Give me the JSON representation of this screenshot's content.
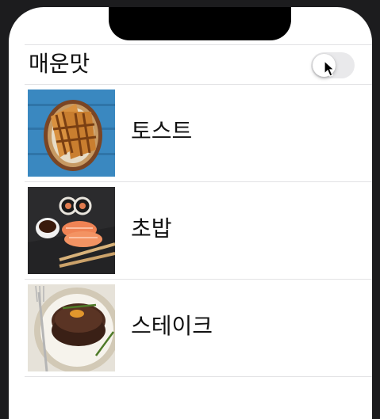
{
  "spicy_toggle": {
    "label": "매운맛",
    "state": "off",
    "track_color": "#e9e9eb",
    "knob_color": "#ffffff"
  },
  "food_items": [
    {
      "name": "토스트",
      "image_icon": "toast-photo"
    },
    {
      "name": "초밥",
      "image_icon": "sushi-photo"
    },
    {
      "name": "스테이크",
      "image_icon": "steak-photo"
    }
  ]
}
